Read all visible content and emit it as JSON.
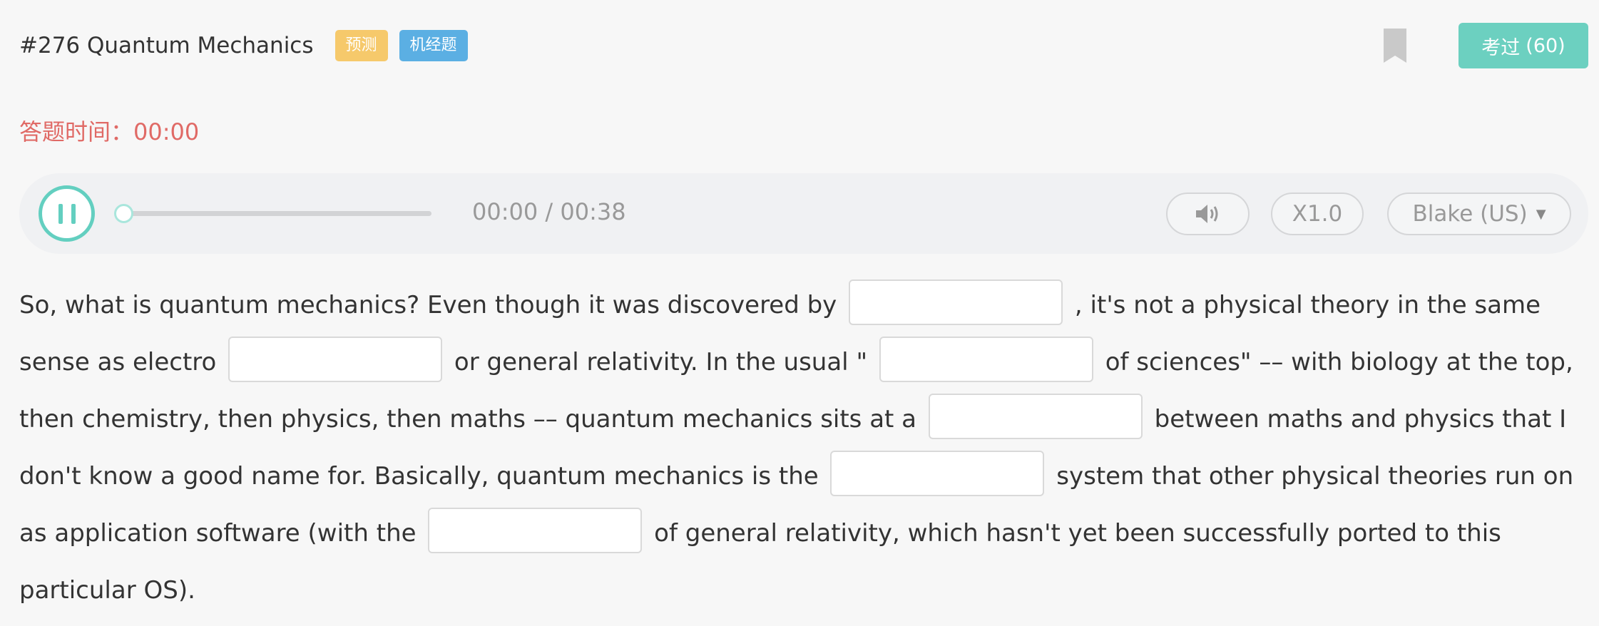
{
  "header": {
    "title": "#276 Quantum Mechanics",
    "badge_predict": "预测",
    "badge_exam": "机经题",
    "passed_label": "考过",
    "passed_count": "(60)",
    "bookmark_icon": "bookmark-icon"
  },
  "timer": {
    "label": "答题时间：",
    "value": "00:00"
  },
  "player": {
    "state_icon": "pause-icon",
    "progress": 0,
    "current_time": "00:00",
    "separator": "/",
    "total_time": "00:38",
    "volume_icon": "speaker-icon",
    "speed": "X1.0",
    "voice": "Blake (US)",
    "voice_dropdown_icon": "caret-down-icon"
  },
  "passage": {
    "segments": [
      "So, what is quantum mechanics? Even though it was discovered by",
      ", it's not a physical theory in the same sense as electro",
      "or general relativity. In the usual \"",
      "of sciences\" –– with biology at the top, then chemistry, then physics, then maths –– quantum mechanics sits at a",
      "between maths and physics that I don't know a good name for. Basically, quantum mechanics is the",
      "system that other physical theories run on as application software (with the",
      "of general relativity, which hasn't yet been successfully ported to this particular OS)."
    ],
    "blanks": [
      "",
      "",
      "",
      "",
      "",
      ""
    ]
  },
  "colors": {
    "accent": "#63cfc0",
    "timer": "#e06a66",
    "badge_predict": "#f6c96b",
    "badge_exam": "#5bafe3"
  }
}
